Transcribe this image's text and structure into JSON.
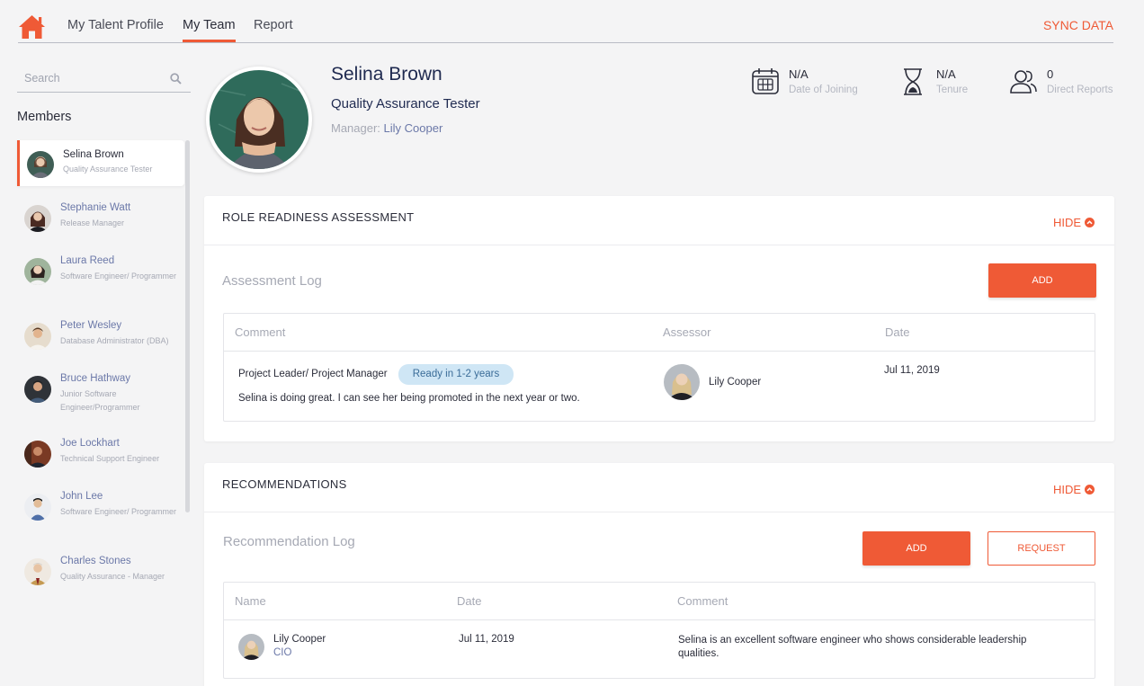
{
  "nav": {
    "tabs": [
      {
        "label": "My Talent Profile"
      },
      {
        "label": "My Team"
      },
      {
        "label": "Report"
      }
    ],
    "active_tab": "My Team",
    "sync_label": "SYNC DATA",
    "accent_color": "#ef5a36"
  },
  "sidebar": {
    "search_placeholder": "Search",
    "members_title": "Members",
    "members": [
      {
        "name": "Selina Brown",
        "role": "Quality Assurance Tester",
        "selected": true
      },
      {
        "name": "Stephanie Watt",
        "role": "Release Manager"
      },
      {
        "name": "Laura Reed",
        "role": "Software Engineer/ Programmer"
      },
      {
        "name": "Peter Wesley",
        "role": "Database Administrator (DBA)"
      },
      {
        "name": "Bruce Hathway",
        "role": "Junior Software Engineer/Programmer"
      },
      {
        "name": "Joe Lockhart",
        "role": "Technical Support Engineer"
      },
      {
        "name": "John Lee",
        "role": "Software Engineer/ Programmer"
      },
      {
        "name": "Charles Stones",
        "role": "Quality Assurance - Manager"
      }
    ]
  },
  "profile": {
    "name": "Selina Brown",
    "title": "Quality Assurance Tester",
    "manager_label": "Manager:",
    "manager_name": "Lily Cooper",
    "stats": [
      {
        "value": "N/A",
        "label": "Date of Joining",
        "icon": "calendar-icon"
      },
      {
        "value": "N/A",
        "label": "Tenure",
        "icon": "hourglass-icon"
      },
      {
        "value": "0",
        "label": "Direct Reports",
        "icon": "people-icon"
      }
    ]
  },
  "readiness": {
    "title": "ROLE READINESS ASSESSMENT",
    "hide_label": "HIDE",
    "log_title": "Assessment Log",
    "add_label": "ADD",
    "columns": [
      "Comment",
      "Assessor",
      "Date"
    ],
    "rows": [
      {
        "role": "Project Leader/ Project Manager",
        "readiness": "Ready in 1-2 years",
        "comment": "Selina is doing great. I can see her being promoted in the next year or two.",
        "assessor": "Lily Cooper",
        "date": "Jul 11, 2019"
      }
    ]
  },
  "recommendations": {
    "title": "RECOMMENDATIONS",
    "hide_label": "HIDE",
    "log_title": "Recommendation Log",
    "add_label": "ADD",
    "request_label": "REQUEST",
    "columns": [
      "Name",
      "Date",
      "Comment"
    ],
    "rows": [
      {
        "name": "Lily Cooper",
        "position": "CIO",
        "date": "Jul 11, 2019",
        "comment": "Selina is an excellent software engineer who shows considerable leadership qualities."
      }
    ]
  }
}
